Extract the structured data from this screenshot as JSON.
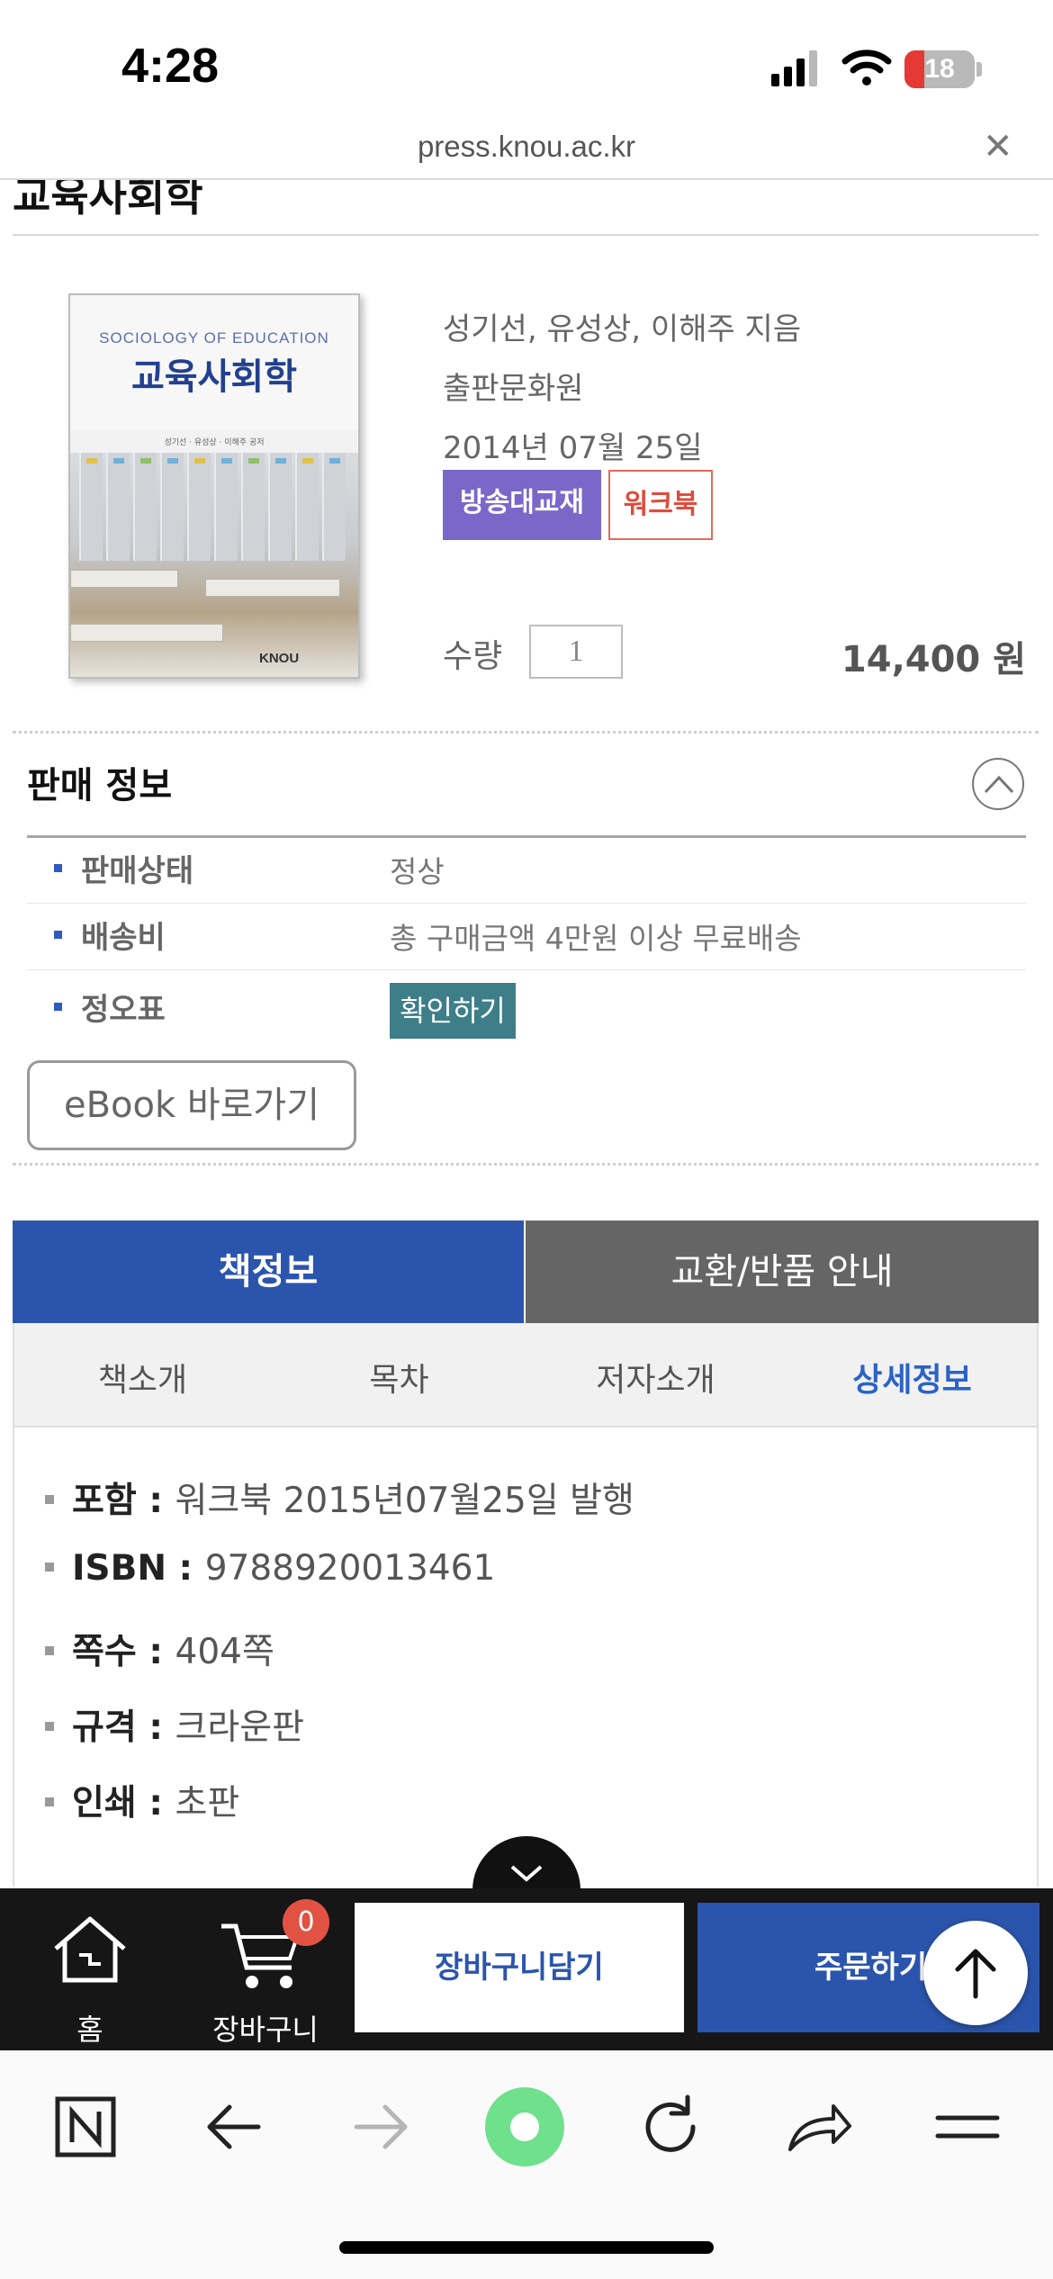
{
  "status_bar": {
    "time": "4:28",
    "battery": "18",
    "battery_level": 0.18,
    "icons": [
      "cellular-signal-icon",
      "wifi-icon",
      "battery-charging-icon"
    ]
  },
  "browser": {
    "url": "press.knou.ac.kr",
    "close_icon": "✕"
  },
  "page": {
    "title": "교육사회학"
  },
  "book": {
    "cover": {
      "en_title": "SOCIOLOGY OF EDUCATION",
      "ko_title": "교육사회학",
      "authors": "성기선 · 유성상 · 이해주 공저",
      "publisher_logo": "KNOU"
    },
    "authors": "성기선, 유성상, 이해주 지음",
    "publisher": "출판문화원",
    "date": "2014년 07월 25일",
    "badges": [
      "방송대교재",
      "워크북"
    ],
    "quantity_label": "수량",
    "quantity": "1",
    "price": "14,400 원"
  },
  "sales_info": {
    "heading": "판매 정보",
    "rows": [
      {
        "label": "판매상태",
        "value": "정상"
      },
      {
        "label": "배송비",
        "value": "총 구매금액 4만원 이상 무료배송"
      },
      {
        "label": "정오표",
        "button": "확인하기"
      }
    ],
    "ebook_button": "eBook 바로가기"
  },
  "tabs": {
    "main": [
      "책정보",
      "교환/반품 안내"
    ],
    "active_main": 0,
    "sub": [
      "책소개",
      "목차",
      "저자소개",
      "상세정보"
    ],
    "active_sub": 3
  },
  "details": [
    {
      "label": "포함",
      "value": "워크북 2015년07월25일 발행"
    },
    {
      "label": "ISBN",
      "value": "9788920013461"
    },
    {
      "label": "쪽수",
      "value": "404쪽"
    },
    {
      "label": "규격",
      "value": "크라운판"
    },
    {
      "label": "인쇄",
      "value": "초판"
    }
  ],
  "bottom_bar": {
    "home_label": "홈",
    "cart_label": "장바구니",
    "cart_count": "0",
    "add_to_cart": "장바구니담기",
    "order": "주문하기"
  },
  "toolbar": {
    "icons": [
      "naver-n-icon",
      "back-arrow-icon",
      "forward-arrow-icon",
      "green-dot-icon",
      "reload-icon",
      "share-icon",
      "menu-icon"
    ]
  },
  "colors": {
    "primary_blue": "#2b55ad",
    "badge_purple": "#7a68c9",
    "badge_red": "#e04b3c",
    "erratum_teal": "#3d7e88",
    "battery_red": "#e53935"
  }
}
